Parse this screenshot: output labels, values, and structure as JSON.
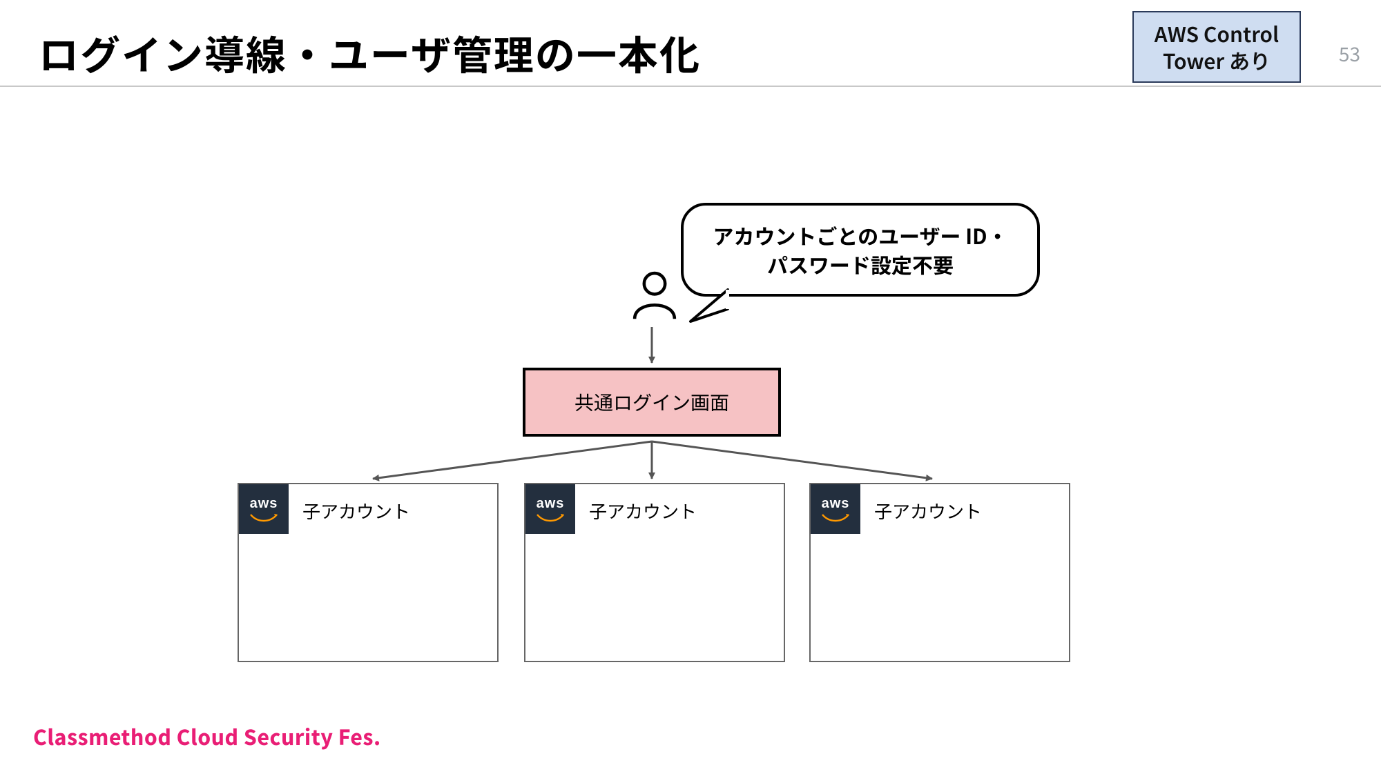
{
  "header": {
    "title": "ログイン導線・ユーザ管理の一本化",
    "badge": "AWS Control Tower あり",
    "page_number": "53"
  },
  "diagram": {
    "speech_bubble": "アカウントごとのユーザー ID・パスワード設定不要",
    "login_box": "共通ログイン画面",
    "aws_logo_text": "aws",
    "children": [
      {
        "label": "子アカウント"
      },
      {
        "label": "子アカウント"
      },
      {
        "label": "子アカウント"
      }
    ]
  },
  "footer": {
    "brand": "Classmethod Cloud Security Fes."
  },
  "colors": {
    "badge_bg": "#cfddf1",
    "badge_border": "#2a3a5a",
    "login_bg": "#f6c2c4",
    "aws_bg": "#232f3e",
    "brand": "#e91e75"
  }
}
